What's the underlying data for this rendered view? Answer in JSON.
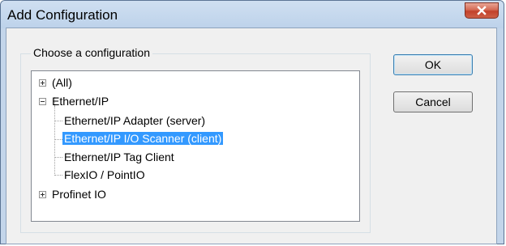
{
  "dialog": {
    "title": "Add Configuration",
    "close_icon": "close-x-icon"
  },
  "group": {
    "legend": "Choose a configuration"
  },
  "tree": {
    "items": [
      {
        "label": "(All)",
        "level": 0,
        "expanded": false,
        "selected": false
      },
      {
        "label": "Ethernet/IP",
        "level": 0,
        "expanded": true,
        "selected": false
      },
      {
        "label": "Ethernet/IP Adapter (server)",
        "level": 1,
        "selected": false
      },
      {
        "label": "Ethernet/IP I/O Scanner (client)",
        "level": 1,
        "selected": true
      },
      {
        "label": "Ethernet/IP Tag Client",
        "level": 1,
        "selected": false
      },
      {
        "label": "FlexIO / PointIO",
        "level": 1,
        "selected": false
      },
      {
        "label": "Profinet IO",
        "level": 0,
        "expanded": false,
        "selected": false
      }
    ]
  },
  "buttons": {
    "ok_label": "OK",
    "cancel_label": "Cancel"
  },
  "colors": {
    "selection": "#3399ff",
    "close_button": "#c2412b",
    "title_bar": "#c3d5ea"
  }
}
